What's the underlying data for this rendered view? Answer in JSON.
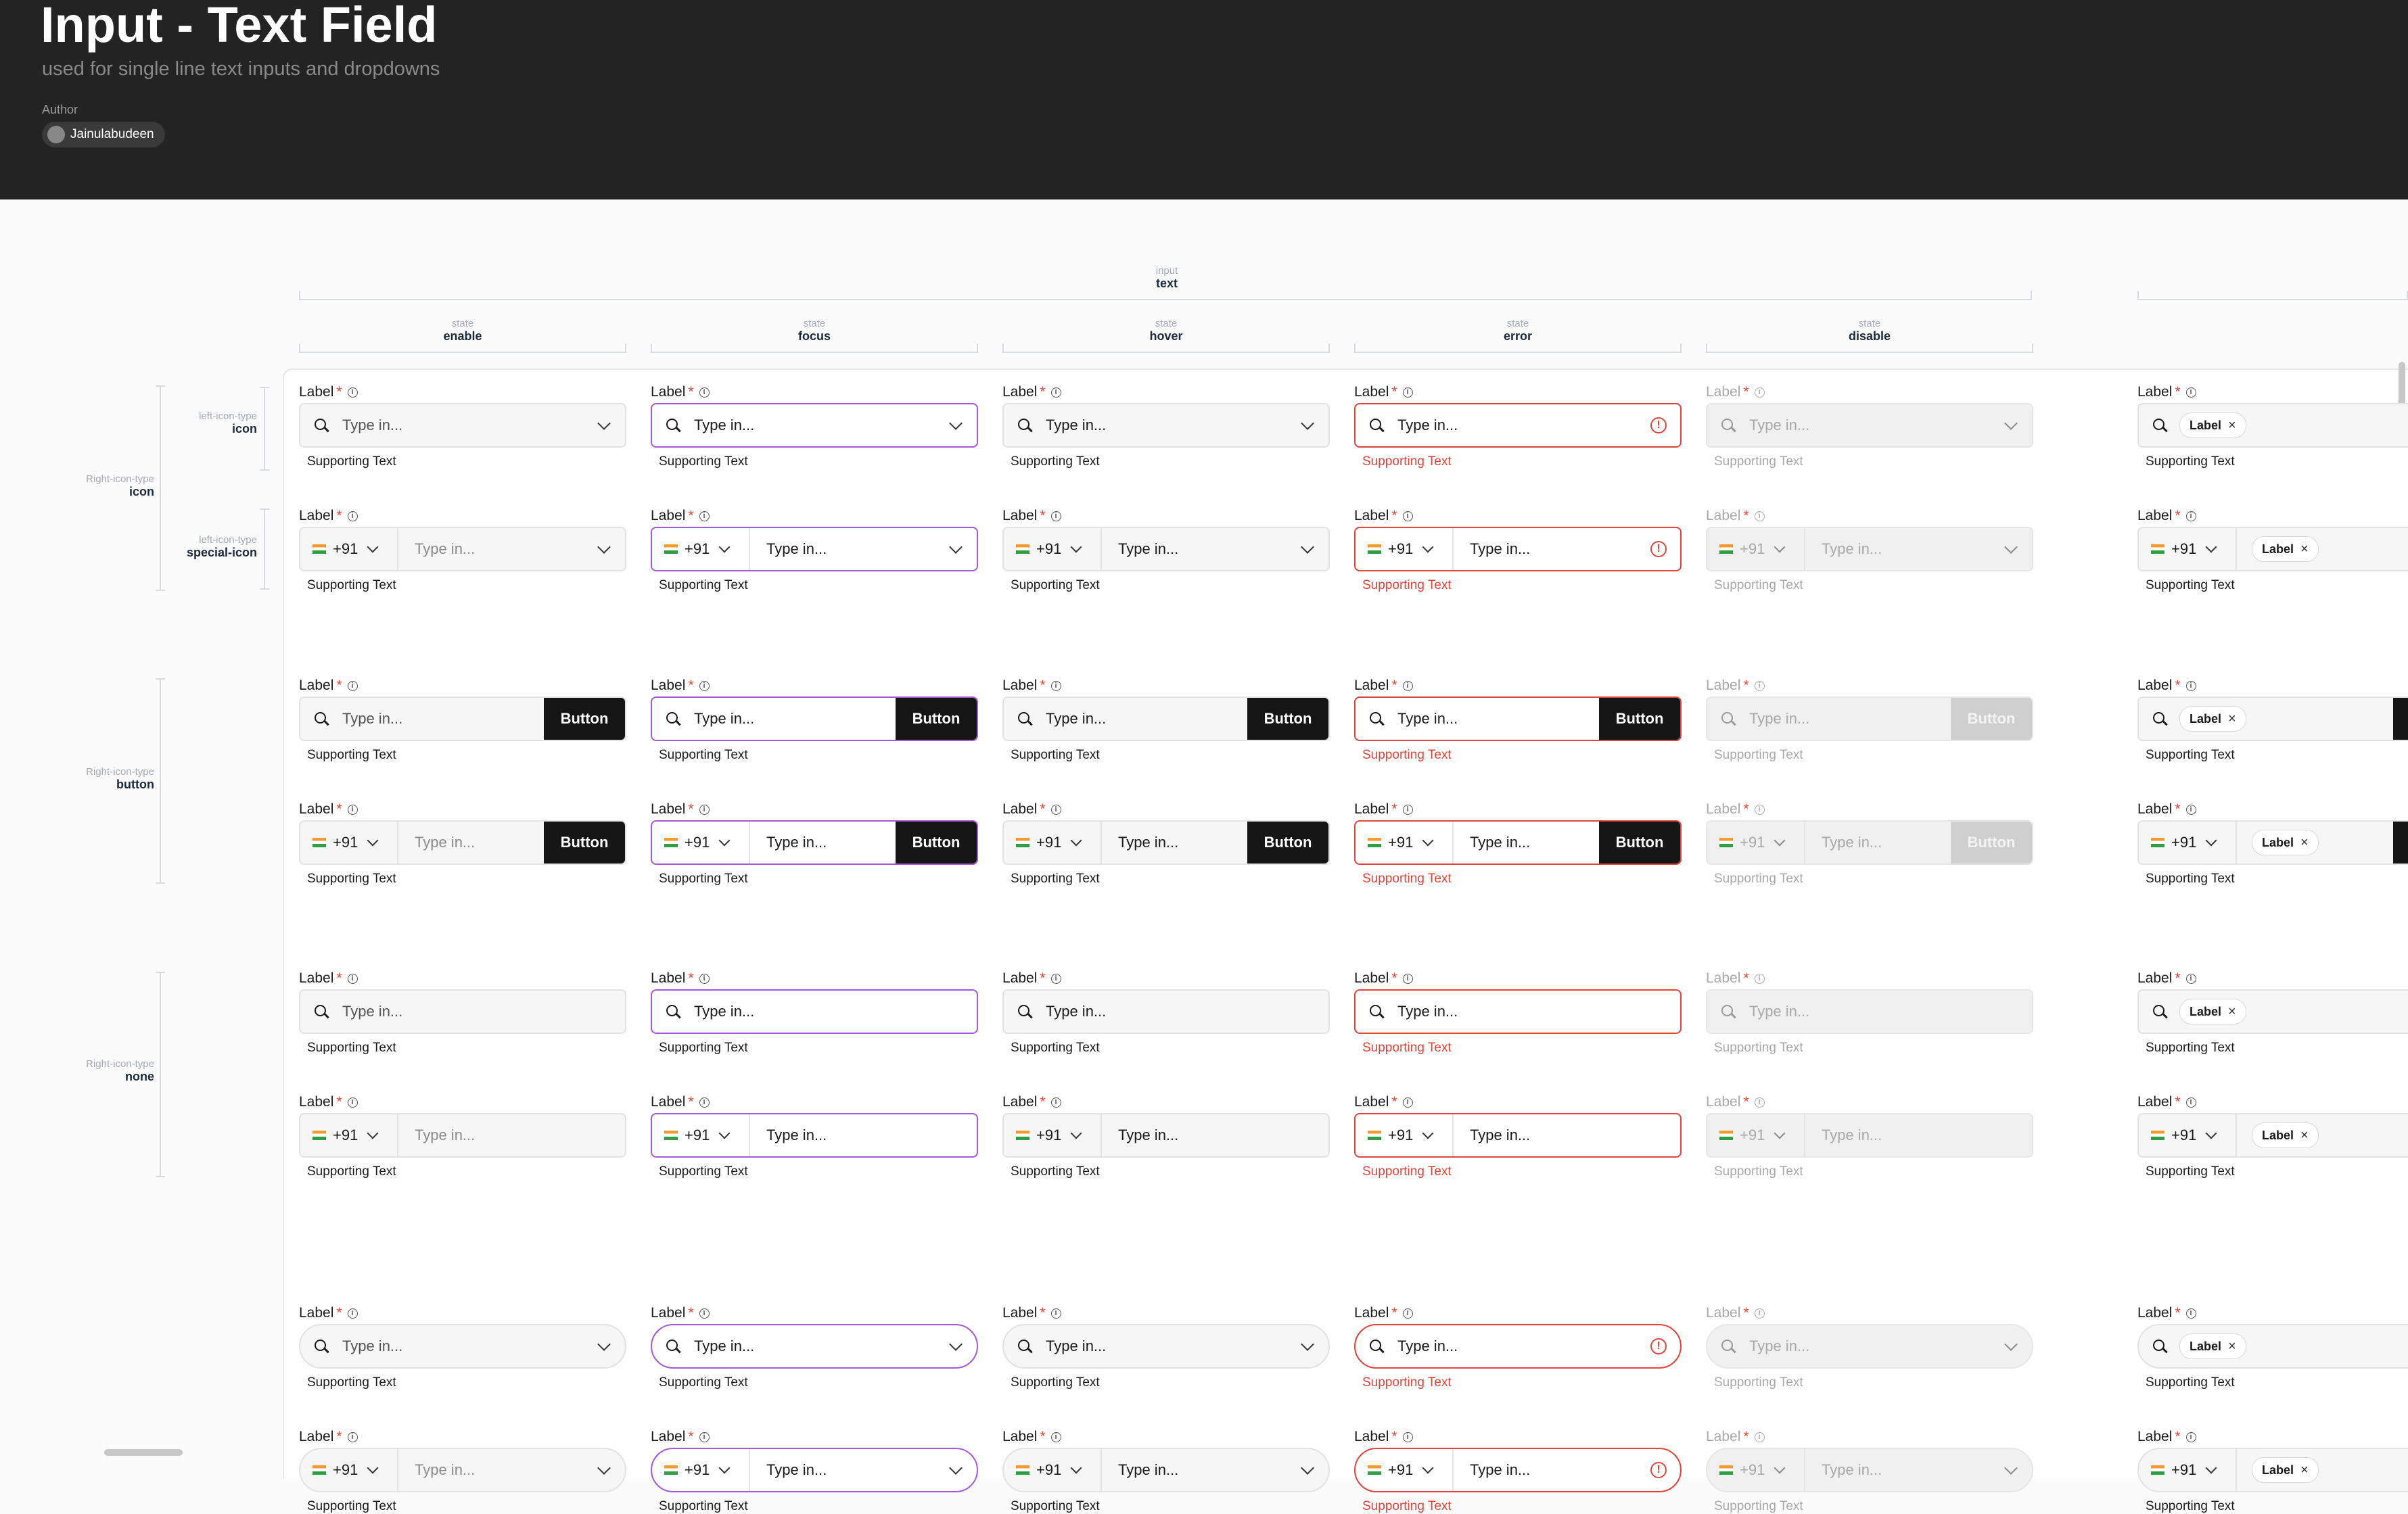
{
  "header": {
    "title": "Input - Text Field",
    "subtitle": "used for single line text inputs and dropdowns",
    "author_label": "Author",
    "author_name": "Jainulabudeen"
  },
  "annotations": {
    "input_key": "input",
    "input_value": "text",
    "state_key": "state",
    "states": [
      "enable",
      "focus",
      "hover",
      "error",
      "disable"
    ],
    "right_icon_key": "Right-icon-type",
    "left_icon_key": "left-icon-type",
    "right_icon_values": [
      "icon",
      "button",
      "none"
    ],
    "left_icon_values": [
      "icon",
      "special-icon"
    ]
  },
  "field": {
    "label": "Label",
    "required_mark": "*",
    "info_glyph": "i",
    "placeholder": "Type in...",
    "supporting_text": "Supporting Text",
    "country_code": "+91",
    "button_label": "Button",
    "chip_label": "Label",
    "chip_close": "×",
    "error_glyph": "!"
  },
  "colors": {
    "header_bg": "#232323",
    "focus_border": "#a45ad8",
    "error": "#e0453b",
    "button_bg": "#151515",
    "disabled_button_bg": "#cfcfcf"
  }
}
